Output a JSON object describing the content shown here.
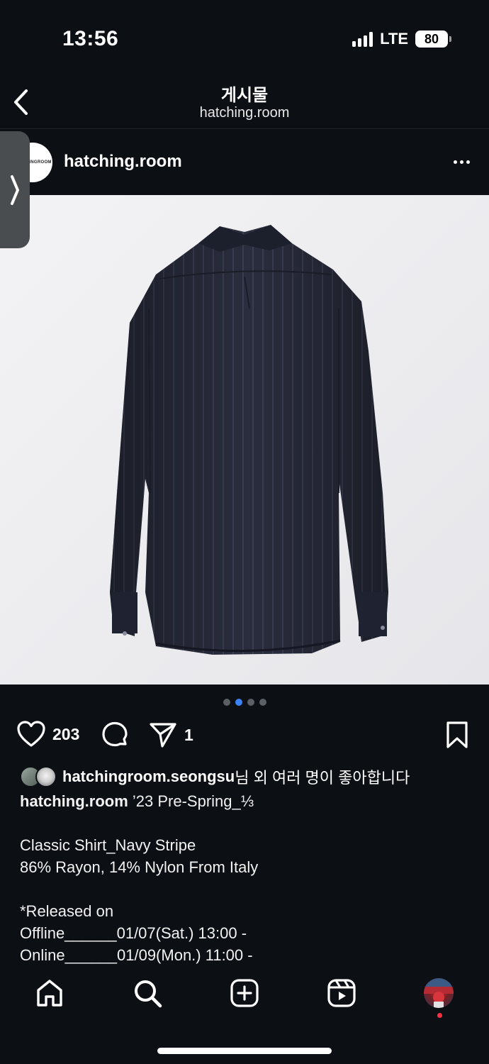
{
  "status": {
    "time": "13:56",
    "network": "LTE",
    "battery": "80"
  },
  "header": {
    "title": "게시물",
    "subtitle": "hatching.room"
  },
  "post": {
    "username": "hatching.room",
    "avatar_text": "HATCHINGROOM",
    "image_icon": "shirt-image",
    "carousel": {
      "count": 4,
      "active": 2
    },
    "likes_count": "203",
    "shares_count": "1",
    "liked_by_user": "hatchingroom.seongsu",
    "liked_by_suffix": "님 외 여러 명이 좋아합니다",
    "caption_user": "hatching.room",
    "caption_lines": [
      " ’23 Pre-Spring_⅓",
      "",
      "Classic Shirt_Navy Stripe",
      "86% Rayon, 14% Nylon From Italy",
      "",
      "*Released on",
      "Offline______01/07(Sat.) 13:00 -",
      "Online______01/09(Mon.) 11:00 -"
    ]
  },
  "icons": {
    "back": "chevron-left-icon",
    "side_handle": "chevron-right-icon",
    "more": "more-horizontal-icon",
    "like": "heart-icon",
    "comment": "comment-icon",
    "share": "send-icon",
    "save": "bookmark-icon",
    "tabs": [
      "home-icon",
      "search-icon",
      "create-icon",
      "reels-icon",
      "profile-avatar"
    ]
  },
  "colors": {
    "background": "#0c1014",
    "accent_dot": "#3b82f6",
    "notification": "#ff3040",
    "shirt": "#2a2d3d"
  }
}
